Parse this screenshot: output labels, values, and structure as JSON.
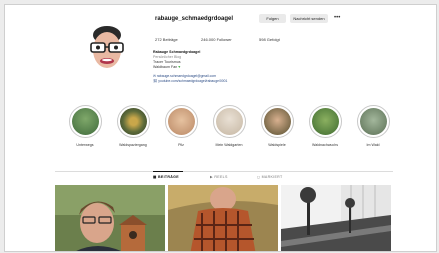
{
  "profile": {
    "username": "rabauge_schmaedgrdoagel",
    "follow_label": "Folgen",
    "message_label": "Nachricht senden",
    "more_label": "•••",
    "stats": {
      "posts": "272 Beiträge",
      "followers": "246.000 Follower",
      "following": "598 Gefolgt"
    },
    "bio": {
      "name": "Rabauge Schmaedgrdoagel",
      "category": "Persönlicher Blog",
      "line1": "Tracer Tourismus",
      "line2": "Waldbaum Fan",
      "email": "rabauge.schmaedgrdoagel@gmail.com",
      "link": "youtube.com/schmaedgrdoagel/rabauge/0001"
    }
  },
  "highlights": [
    {
      "label": "Unterwegs"
    },
    {
      "label": "Waldspaziergang"
    },
    {
      "label": "Pilz"
    },
    {
      "label": "Mein Waldgarten"
    },
    {
      "label": "Waldspiele"
    },
    {
      "label": "Waldnachwuchs"
    },
    {
      "label": "Im Wald"
    }
  ],
  "tabs": [
    {
      "label": "▦ BEITRÄGE"
    },
    {
      "label": "▶ REELS"
    },
    {
      "label": "◻ MARKIERT"
    }
  ],
  "colors": {
    "link": "#2d4d86",
    "button_bg": "#eaeaea"
  }
}
